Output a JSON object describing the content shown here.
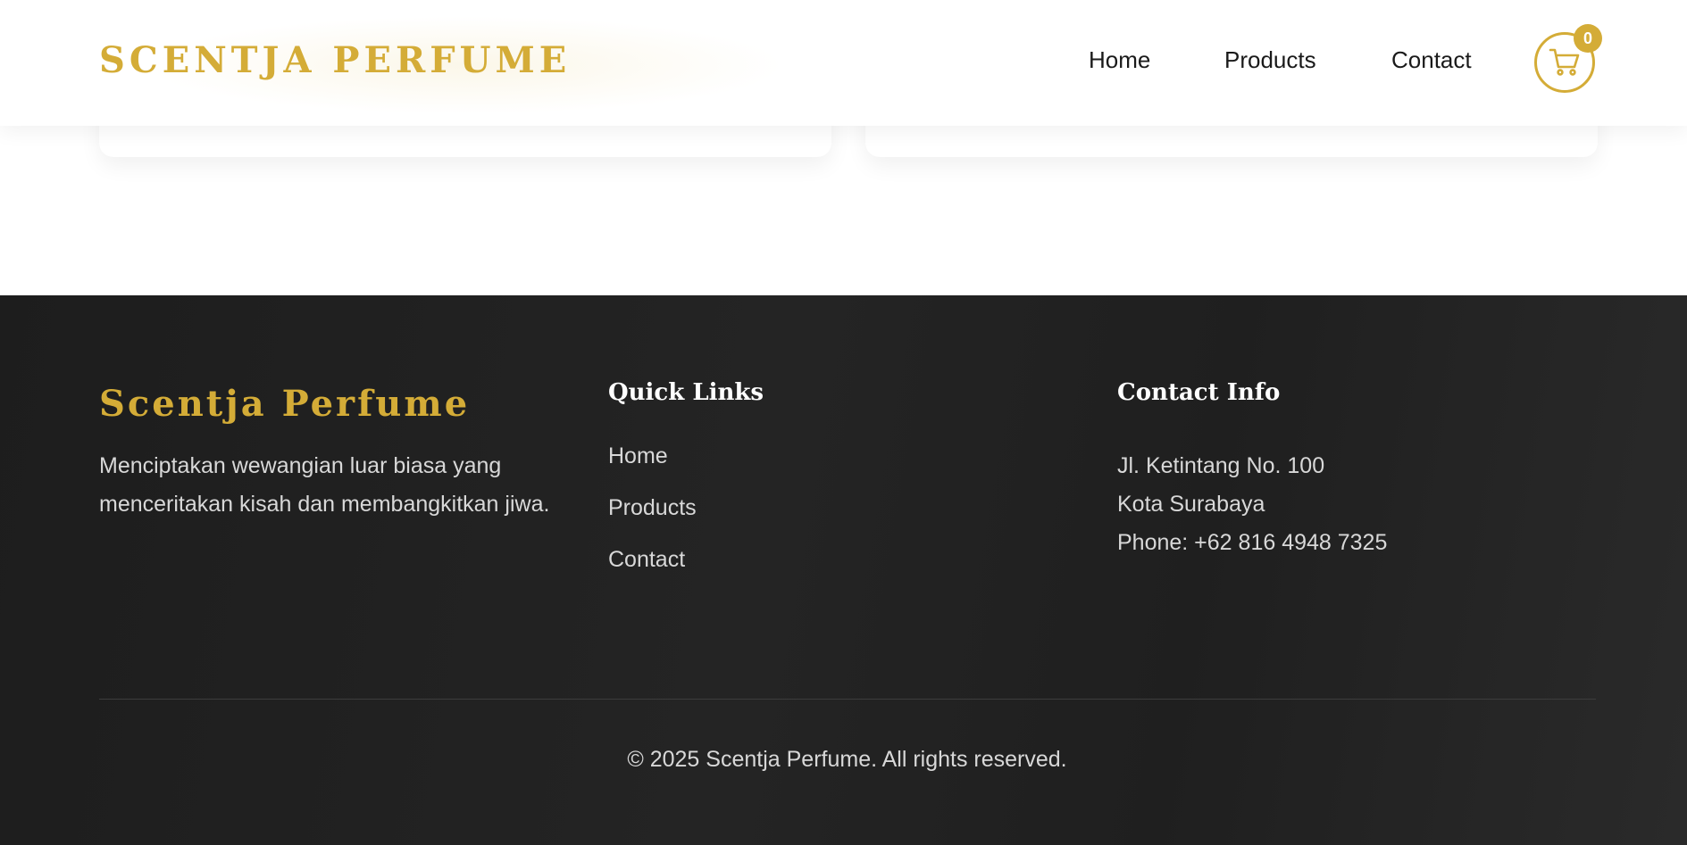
{
  "colors": {
    "accent_gold": "#d4ac37",
    "footer_bg": "#212121",
    "footer_text": "#d8d8d8",
    "nav_text": "#1a1a1a"
  },
  "header": {
    "logo": "SCENTJA PERFUME",
    "nav": {
      "home": "Home",
      "products": "Products",
      "contact": "Contact"
    },
    "cart": {
      "icon": "shopping-cart-icon",
      "count": "0"
    }
  },
  "footer": {
    "brand": "Scentja Perfume",
    "description": "Menciptakan wewangian luar biasa yang menceritakan kisah dan membangkitkan jiwa.",
    "quick_links": {
      "heading": "Quick Links",
      "items": [
        "Home",
        "Products",
        "Contact"
      ]
    },
    "contact_info": {
      "heading": "Contact Info",
      "address_line1": "Jl. Ketintang No. 100",
      "address_line2": "Kota Surabaya",
      "phone": "Phone: +62 816 4948 7325"
    },
    "copyright": "© 2025 Scentja Perfume. All rights reserved."
  }
}
